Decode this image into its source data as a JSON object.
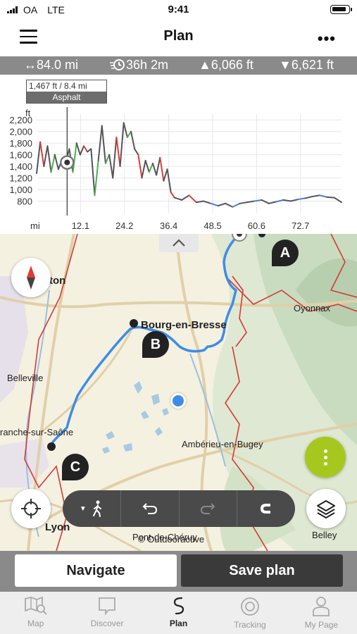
{
  "status_bar": {
    "carrier": "OA",
    "network": "LTE",
    "time": "9:41"
  },
  "header": {
    "title": "Plan",
    "menu_icon": "hamburger-menu-icon",
    "more_icon": "more-dots-icon"
  },
  "stats": {
    "distance": "↔84.0 mi",
    "duration": "36h 2m",
    "ascent": "▲6,066 ft",
    "descent": "▼6,621 ft"
  },
  "chart_data": {
    "type": "line",
    "ylabel": "ft",
    "xlabel": "mi",
    "x_ticks": [
      "12.1",
      "24.2",
      "36.4",
      "48.5",
      "60.6",
      "72.7"
    ],
    "y_ticks": [
      "800",
      "1,000",
      "1,200",
      "1,400",
      "1,600",
      "1,800",
      "2,000",
      "2,200"
    ],
    "xlim": [
      0,
      84
    ],
    "ylim": [
      600,
      2300
    ],
    "grid": true,
    "series": [
      {
        "x": [
          0,
          1,
          2,
          3,
          4,
          5,
          6,
          7,
          8,
          9,
          10,
          11,
          12,
          13,
          14,
          15,
          16,
          17,
          18,
          19,
          20,
          21,
          22,
          23,
          24,
          25,
          26,
          27,
          28,
          29,
          30,
          31,
          32,
          33,
          34,
          35,
          36,
          37,
          38,
          40,
          42,
          44,
          46,
          48,
          50,
          52,
          54,
          56,
          58,
          60,
          62,
          64,
          66,
          68,
          70,
          72,
          74,
          76,
          78,
          80,
          82,
          84
        ],
        "y": [
          1280,
          1820,
          1400,
          1750,
          1300,
          1600,
          1350,
          1520,
          1467,
          1700,
          1300,
          1800,
          1600,
          1750,
          1650,
          1700,
          900,
          1500,
          2100,
          1450,
          1600,
          1200,
          1900,
          1400,
          2150,
          1900,
          2000,
          1700,
          1600,
          1200,
          1500,
          1300,
          1450,
          1250,
          1550,
          1150,
          1350,
          950,
          860,
          820,
          900,
          780,
          800,
          760,
          720,
          760,
          700,
          760,
          780,
          800,
          820,
          760,
          790,
          820,
          800,
          830,
          850,
          880,
          900,
          870,
          860,
          780
        ]
      }
    ],
    "cursor": {
      "x": 8.4,
      "y": 1467
    },
    "tooltip": {
      "value": "1,467 ft / 8.4 mi",
      "surface": "Asphalt"
    },
    "colors": {
      "line": "#555555",
      "up": "#4caf50",
      "down": "#e53935",
      "flat": "#4a7fd4"
    }
  },
  "map": {
    "labels": {
      "city_ton": "ton",
      "bourg": "Bourg-en-Bresse",
      "oyonnax": "Oyonnax",
      "belleville": "Belleville",
      "villefranche": "ranche-sur-Saône",
      "amberieu": "Ambérieu-en-Bugey",
      "lyon": "Lyon",
      "pont": "Pont-de-Chéruy",
      "belley": "Belley"
    },
    "markers": [
      "A",
      "B",
      "C"
    ],
    "copyright": "© Outdooractive",
    "route_color": "#3d8de6"
  },
  "actions": {
    "navigate": "Navigate",
    "save": "Save plan"
  },
  "tabs": [
    {
      "label": "Map",
      "icon": "map-icon",
      "active": false
    },
    {
      "label": "Discover",
      "icon": "discover-icon",
      "active": false
    },
    {
      "label": "Plan",
      "icon": "plan-route-icon",
      "active": true
    },
    {
      "label": "Tracking",
      "icon": "tracking-icon",
      "active": false
    },
    {
      "label": "My Page",
      "icon": "user-icon",
      "active": false
    }
  ]
}
